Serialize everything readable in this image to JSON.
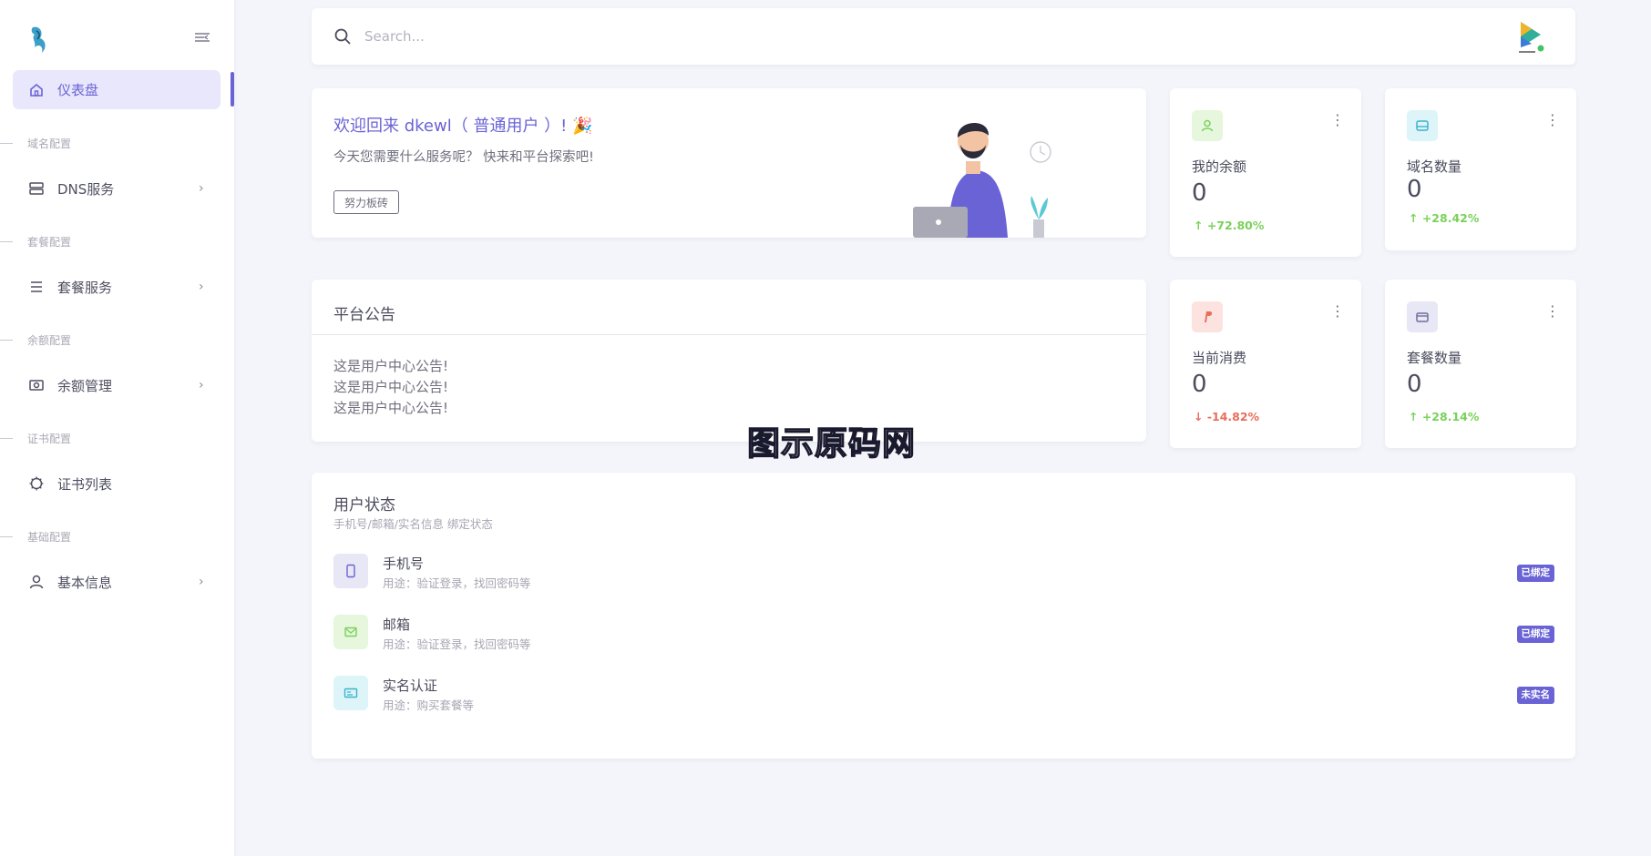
{
  "sidebar": {
    "active_item": "仪表盘",
    "sections": [
      {
        "title": "域名配置",
        "item": "DNS服务"
      },
      {
        "title": "套餐配置",
        "item": "套餐服务"
      },
      {
        "title": "余额配置",
        "item": "余额管理"
      },
      {
        "title": "证书配置",
        "item": "证书列表"
      },
      {
        "title": "基础配置",
        "item": "基本信息"
      }
    ]
  },
  "search": {
    "placeholder": "Search..."
  },
  "welcome": {
    "title": "欢迎回来 dkewl（ 普通用户 ）! 🎉",
    "subtitle": "今天您需要什么服务呢？ 快来和平台探索吧!",
    "button": "努力板砖"
  },
  "notice": {
    "title": "平台公告",
    "lines": [
      "这是用户中心公告!",
      "这是用户中心公告!",
      "这是用户中心公告!"
    ]
  },
  "stats": [
    {
      "label": "我的余额",
      "value": "0",
      "trend": "+72.80%",
      "direction": "up",
      "icon": "user-icon"
    },
    {
      "label": "域名数量",
      "value": "0",
      "trend": "+28.42%",
      "direction": "up",
      "icon": "server-icon"
    },
    {
      "label": "当前消费",
      "value": "0",
      "trend": "-14.82%",
      "direction": "down",
      "icon": "paypal-icon"
    },
    {
      "label": "套餐数量",
      "value": "0",
      "trend": "+28.14%",
      "direction": "up",
      "icon": "wallet-icon"
    }
  ],
  "user_status": {
    "title": "用户状态",
    "subtitle": "手机号/邮箱/实名信息 绑定状态",
    "rows": [
      {
        "name": "手机号",
        "desc": "用途：验证登录，找回密码等",
        "badge": "已绑定",
        "icon": "phone-icon"
      },
      {
        "name": "邮箱",
        "desc": "用途：验证登录，找回密码等",
        "badge": "已绑定",
        "icon": "mail-icon"
      },
      {
        "name": "实名认证",
        "desc": "用途：购买套餐等",
        "badge": "未实名",
        "icon": "id-card-icon"
      }
    ]
  },
  "watermark": "图示原码网",
  "colors": {
    "primary": "#6a63d6",
    "up": "#7ad15a",
    "down": "#e86d5a",
    "background": "#f4f5fa"
  }
}
